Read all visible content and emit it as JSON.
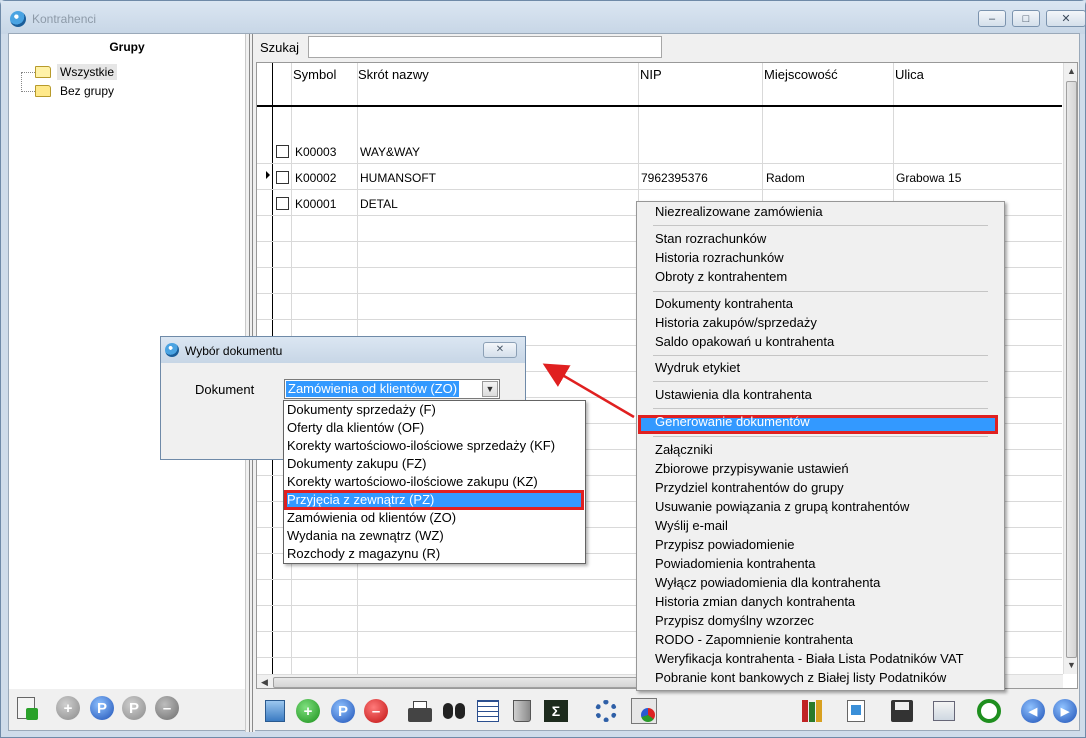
{
  "window": {
    "title": "Kontrahenci",
    "min_label": "–",
    "max_label": "□",
    "close_label": "✕"
  },
  "left": {
    "title": "Grupy",
    "tree": [
      {
        "label": "Wszystkie"
      },
      {
        "label": "Bez grupy"
      }
    ]
  },
  "search": {
    "label": "Szukaj",
    "value": ""
  },
  "grid": {
    "columns": [
      "Symbol",
      "Skrót nazwy",
      "NIP",
      "Miejscowość",
      "Ulica"
    ],
    "rows": [
      {
        "symbol": "K00003",
        "name": "WAY&WAY",
        "nip": "",
        "city": "",
        "street": ""
      },
      {
        "symbol": "K00002",
        "name": "HUMANSOFT",
        "nip": "7962395376",
        "city": "Radom",
        "street": "Grabowa 15"
      },
      {
        "symbol": "K00001",
        "name": "DETAL",
        "nip": "",
        "city": "",
        "street": ""
      }
    ]
  },
  "context_menu": {
    "items": [
      "Niezrealizowane zamówienia",
      "Stan rozrachunków",
      "Historia rozrachunków",
      "Obroty z kontrahentem",
      "Dokumenty kontrahenta",
      "Historia zakupów/sprzedaży",
      "Saldo opakowań u kontrahenta",
      "Wydruk etykiet",
      "Ustawienia dla kontrahenta",
      "Generowanie dokumentów",
      "Załączniki",
      "Zbiorowe przypisywanie ustawień",
      "Przydziel kontrahentów do grupy",
      "Usuwanie powiązania z grupą kontrahentów",
      "Wyślij e-mail",
      "Przypisz powiadomienie",
      "Powiadomienia kontrahenta",
      "Wyłącz powiadomienia dla kontrahenta",
      "Historia zmian danych kontrahenta",
      "Przypisz domyślny wzorzec",
      "RODO - Zapomnienie kontrahenta",
      "Weryfikacja kontrahenta - Biała Lista Podatników VAT",
      "Pobranie kont bankowych z Białej listy Podatników"
    ],
    "highlighted": "Generowanie dokumentów"
  },
  "dialog": {
    "title": "Wybór dokumentu",
    "close_label": "✕",
    "field_label": "Dokument",
    "selected_value": "Zamówienia od klientów (ZO)",
    "options": [
      "Dokumenty sprzedaży (F)",
      "Oferty dla klientów (OF)",
      "Korekty wartościowo-ilościowe sprzedaży  (KF)",
      "Dokumenty zakupu (FZ)",
      "Korekty wartościowo-ilościowe zakupu (KZ)",
      "Przyjęcia z zewnątrz (PZ)",
      "Zamówienia od klientów (ZO)",
      "Wydania na zewnątrz (WZ)",
      "Rozchody z magazynu (R)"
    ],
    "highlighted_option": "Przyjęcia z zewnątrz (PZ)"
  },
  "toolbar_left": [
    {
      "icon": "import-document-icon"
    },
    {
      "icon": "add-icon",
      "glyph": "+"
    },
    {
      "icon": "search-icon",
      "glyph": "P"
    },
    {
      "icon": "p-icon",
      "glyph": "P"
    },
    {
      "icon": "remove-icon",
      "glyph": "–"
    }
  ],
  "toolbar_main": [
    {
      "icon": "import-icon"
    },
    {
      "icon": "add-icon",
      "glyph": "+"
    },
    {
      "icon": "search-icon",
      "glyph": "P"
    },
    {
      "icon": "delete-icon",
      "glyph": "–"
    },
    {
      "icon": "print-icon"
    },
    {
      "icon": "binoculars-icon"
    },
    {
      "icon": "table-icon"
    },
    {
      "icon": "trash-icon"
    },
    {
      "icon": "sum-icon",
      "glyph": "Σ"
    },
    {
      "icon": "settings-icon"
    },
    {
      "icon": "chart-icon"
    },
    {
      "icon": "books-icon"
    },
    {
      "icon": "document-icon"
    },
    {
      "icon": "save-icon"
    },
    {
      "icon": "copy-icon"
    },
    {
      "icon": "refresh-icon"
    },
    {
      "icon": "previous-icon",
      "glyph": "◀"
    },
    {
      "icon": "next-icon",
      "glyph": "▶"
    }
  ]
}
